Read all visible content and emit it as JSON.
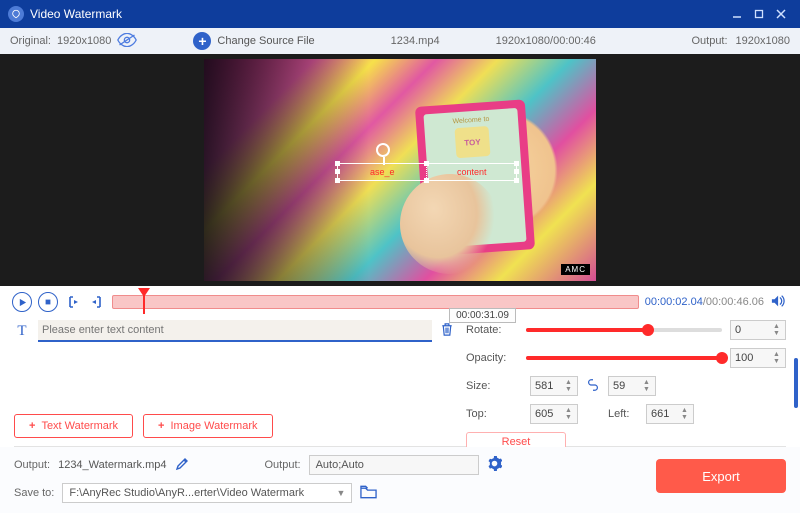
{
  "titlebar": {
    "title": "Video Watermark"
  },
  "toolbar": {
    "original_label": "Original:",
    "original_res": "1920x1080",
    "change_source": "Change Source File",
    "filename": "1234.mp4",
    "res_time": "1920x1080/00:00:46",
    "output_label": "Output:",
    "output_res": "1920x1080"
  },
  "video": {
    "card_welcome": "Welcome to",
    "card_brand": "TOY",
    "amc": "amc",
    "sel_left": "ase_e",
    "sel_right": "content"
  },
  "controls": {
    "tooltip": "00:00:31.09",
    "current": "00:00:02.04",
    "duration": "/00:00:46.06"
  },
  "text_panel": {
    "placeholder": "Please enter text content",
    "text_wm": "Text Watermark",
    "image_wm": "Image Watermark"
  },
  "props": {
    "rotate_label": "Rotate:",
    "rotate_val": "0",
    "rotate_pct": 62,
    "opacity_label": "Opacity:",
    "opacity_val": "100",
    "opacity_pct": 100,
    "size_label": "Size:",
    "size_w": "581",
    "size_h": "59",
    "top_label": "Top:",
    "top_val": "605",
    "left_label": "Left:",
    "left_val": "661",
    "reset": "Reset"
  },
  "footer": {
    "out_label1": "Output:",
    "out_file": "1234_Watermark.mp4",
    "out_label2": "Output:",
    "out_format": "Auto;Auto",
    "save_label": "Save to:",
    "save_path": "F:\\AnyRec Studio\\AnyR...erter\\Video Watermark",
    "export": "Export"
  }
}
